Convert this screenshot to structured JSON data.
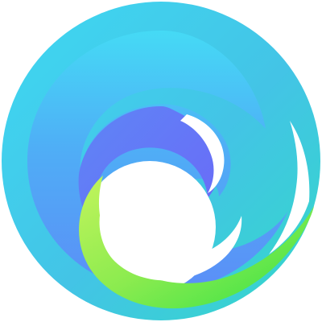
{
  "logo": {
    "icon": "wave-swirl-logo",
    "colors": {
      "outer_teal": "#36D6CF",
      "cyan": "#3FD8F2",
      "mid_blue": "#4FA4F5",
      "periwinkle": "#6A6CF8",
      "lime": "#B7F25A",
      "green": "#38E243",
      "background": "#FFFFFF"
    }
  }
}
